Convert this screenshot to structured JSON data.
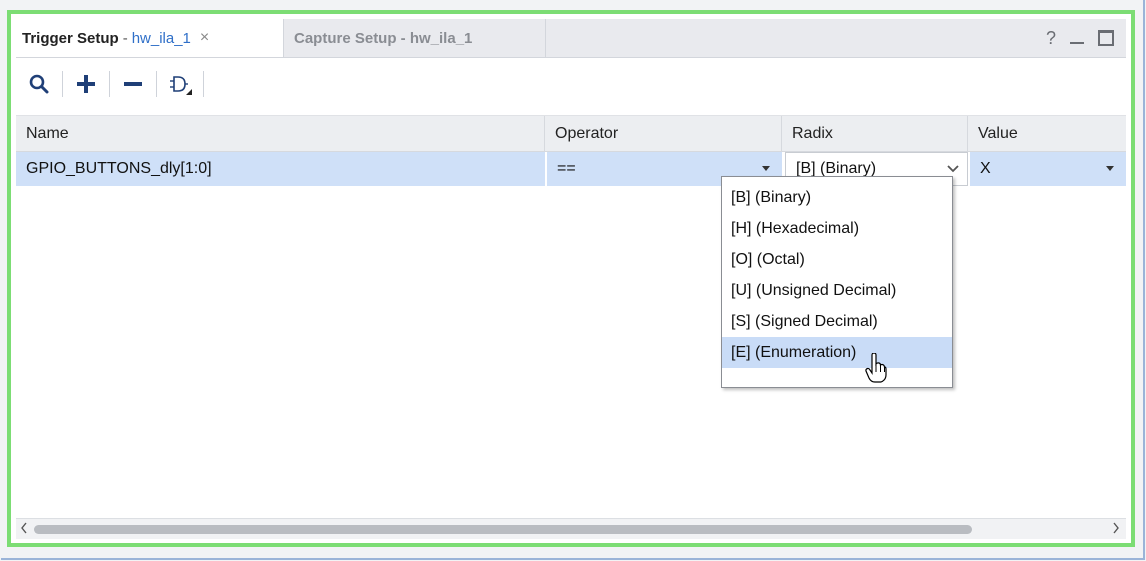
{
  "tabs": {
    "active": {
      "title": "Trigger Setup",
      "separator": "-",
      "probe": "hw_ila_1",
      "close": "×"
    },
    "inactive": {
      "title": "Capture Setup - hw_ila_1"
    }
  },
  "window_controls": {
    "help": "?"
  },
  "toolbar": {
    "buttons": [
      "search-icon",
      "add-icon",
      "remove-icon",
      "gate-icon"
    ]
  },
  "table": {
    "headers": {
      "name": "Name",
      "operator": "Operator",
      "radix": "Radix",
      "value": "Value"
    },
    "rows": [
      {
        "name": "GPIO_BUTTONS_dly[1:0]",
        "operator": "==",
        "radix": "[B]  (Binary)",
        "value": "X"
      }
    ]
  },
  "radix_dropdown": {
    "options": [
      "[B]  (Binary)",
      "[H]  (Hexadecimal)",
      "[O]  (Octal)",
      "[U]  (Unsigned Decimal)",
      "[S]  (Signed Decimal)",
      "[E]  (Enumeration)"
    ],
    "highlighted_index": 5
  },
  "colors": {
    "frame_highlight": "#7cdd74",
    "selection": "#cfe0f8",
    "link": "#2f6fc8",
    "icon": "#1f3f77"
  }
}
